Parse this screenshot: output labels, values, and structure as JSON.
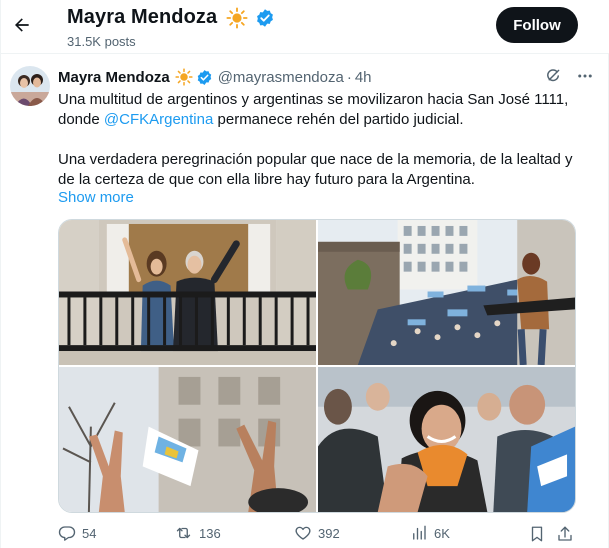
{
  "header": {
    "name": "Mayra Mendoza",
    "posts_count": "31.5K posts",
    "follow_label": "Follow"
  },
  "tweet": {
    "author_name": "Mayra Mendoza",
    "author_handle": "@mayrasmendoza",
    "separator": "·",
    "timestamp": "4h",
    "paragraph1_before": "Una multitud de argentinos y argentinas se movilizaron hacia San José 1111, donde ",
    "mention": "@CFKArgentina",
    "paragraph1_after": " permanece rehén del partido judicial.",
    "paragraph2": "Una verdadera peregrinación popular que nace de la memoria, de la lealtad y de la certeza de que con ella libre hay futuro para la Argentina.",
    "show_more": "Show more",
    "media_icons": [
      "balcony-photo",
      "crowd-photo",
      "raised-hands-photo",
      "embrace-photo"
    ]
  },
  "actions": {
    "replies": "54",
    "reposts": "136",
    "likes": "392",
    "views": "6K"
  },
  "colors": {
    "accent": "#1d9bf0",
    "text": "#0f1419",
    "secondary": "#536471",
    "repost_green": "#00ba7c",
    "verified": "#1d9bf0",
    "sun": "#f5a623"
  }
}
